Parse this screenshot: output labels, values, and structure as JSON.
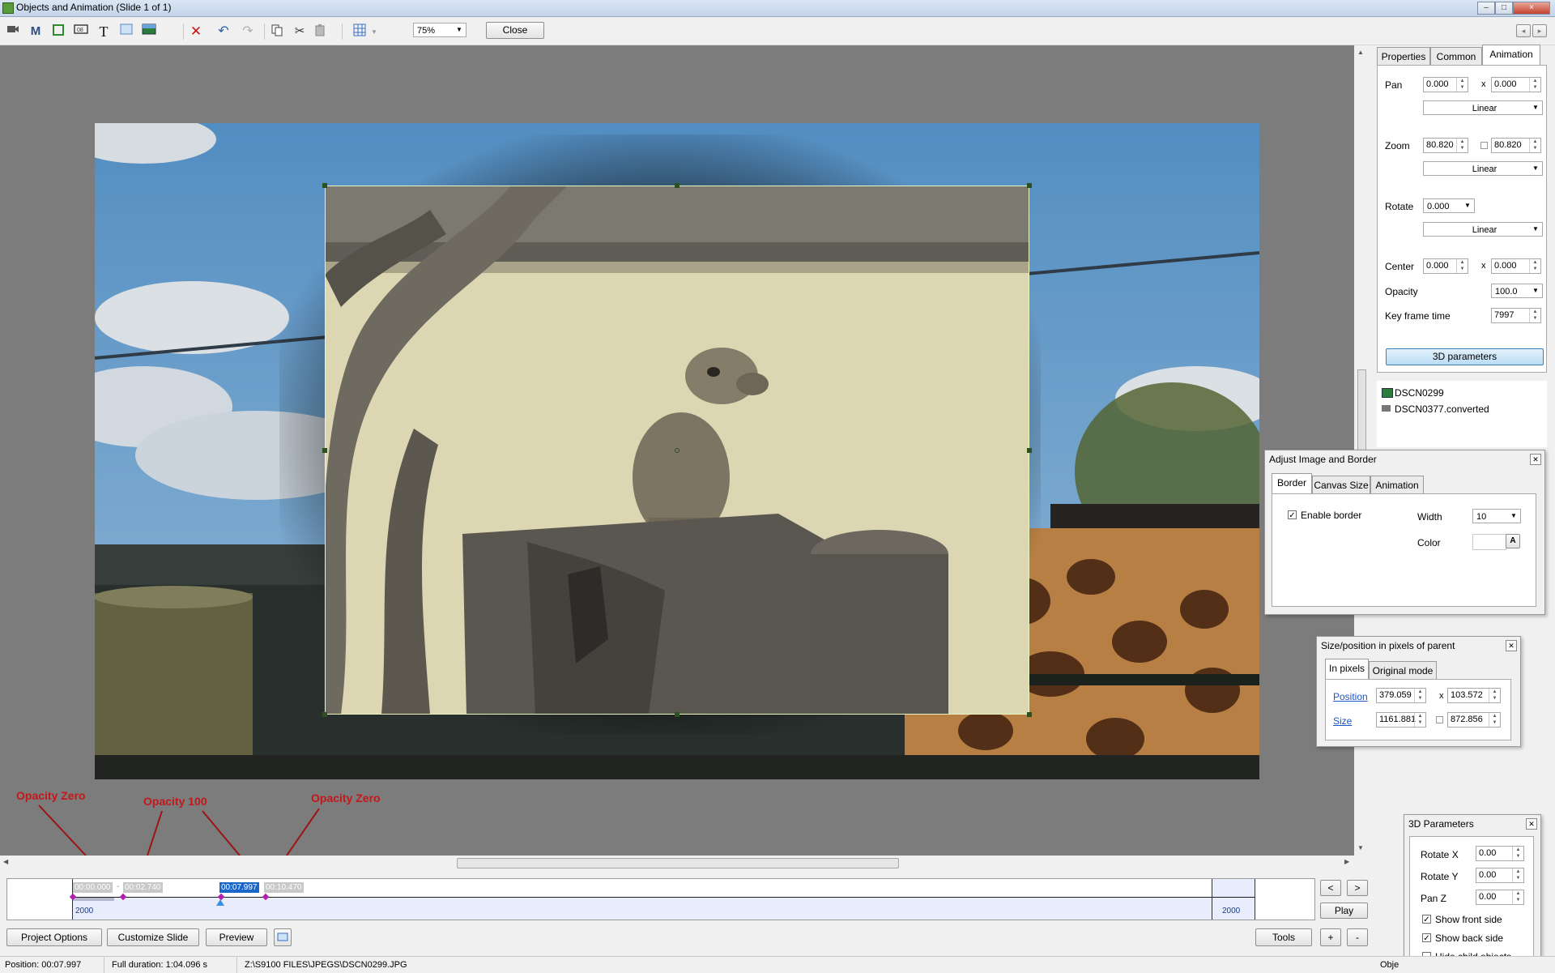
{
  "window": {
    "title": "Objects and Animation  (Slide 1 of 1)",
    "controls": [
      "–",
      "□",
      "×"
    ]
  },
  "toolbar": {
    "zoom_value": "75%",
    "close_label": "Close",
    "nav": [
      "◂",
      "▸"
    ]
  },
  "annotations": {
    "a1": "Opacity Zero",
    "a2": "Opacity 100",
    "a3": "Opacity Zero"
  },
  "properties": {
    "tabs": [
      "Properties",
      "Common",
      "Animation"
    ],
    "pan_label": "Pan",
    "pan_x": "0.000",
    "pan_y": "0.000",
    "x_sep": "x",
    "pan_curve": "Linear",
    "zoom_label": "Zoom",
    "zoom_x": "80.820",
    "zoom_y": "80.820",
    "zoom_curve": "Linear",
    "rotate_label": "Rotate",
    "rotate_value": "0.000",
    "rotate_curve": "Linear",
    "center_label": "Center",
    "center_x": "0.000",
    "center_y": "0.000",
    "opacity_label": "Opacity",
    "opacity_value": "100.0",
    "keyframe_label": "Key frame time",
    "keyframe_value": "7997",
    "params3d_button": "3D parameters"
  },
  "objects": [
    "DSCN0299",
    "DSCN0377.converted"
  ],
  "adjust_dialog": {
    "title": "Adjust Image and Border",
    "tabs": [
      "Border",
      "Canvas Size",
      "Animation"
    ],
    "enable_border_label": "Enable border",
    "width_label": "Width",
    "width_value": "10",
    "color_label": "Color",
    "color_button": "A"
  },
  "size_dialog": {
    "title": "Size/position in pixels of parent",
    "tabs": [
      "In pixels",
      "Original mode"
    ],
    "position_label": "Position",
    "pos_x": "379.059",
    "pos_y": "103.572",
    "size_label": "Size",
    "size_w": "1161.881",
    "size_h": "872.856"
  },
  "params3d": {
    "title": "3D Parameters",
    "rotate_x_label": "Rotate X",
    "rotate_x": "0.00",
    "rotate_y_label": "Rotate Y",
    "rotate_y": "0.00",
    "pan_z_label": "Pan Z",
    "pan_z": "0.00",
    "show_front": "Show front side",
    "show_back": "Show back side",
    "hide_child": "Hide child objects"
  },
  "timeline": {
    "markers": [
      "00:00.000",
      "00:02.740",
      "00:07.997",
      "00:10.470"
    ],
    "marker_sep": "-",
    "left_label": "2000",
    "right_label": "2000",
    "prev_btn": "<",
    "next_btn": ">",
    "play_btn": "Play",
    "plus_btn": "+",
    "minus_btn": "-"
  },
  "bottom": {
    "project_options": "Project Options",
    "customize_slide": "Customize Slide",
    "preview": "Preview",
    "tools": "Tools"
  },
  "status": {
    "position": "Position:  00:07.997",
    "duration": "Full duration: 1:04.096 s",
    "path": "Z:\\S9100 FILES\\JPEGS\\DSCN0299.JPG",
    "cut_label": "Obje"
  },
  "colors": {
    "accent_blue": "#1b66c9",
    "annotation_red": "#c3171b",
    "selection_border": "#e8f7c0"
  }
}
